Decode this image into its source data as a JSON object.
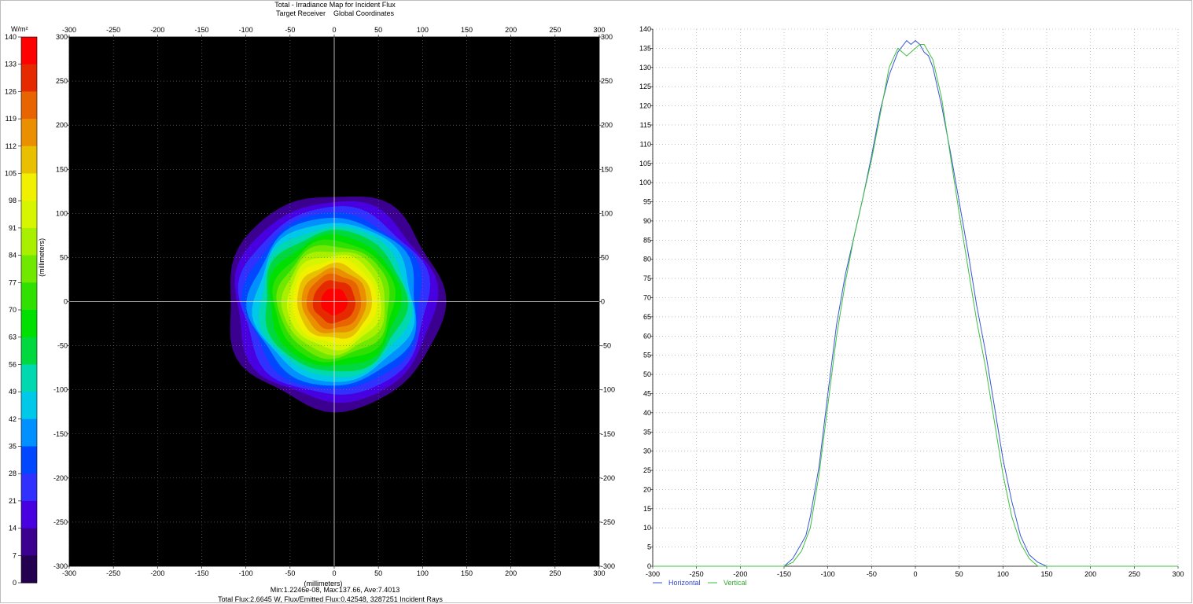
{
  "header": {
    "title": "Total - Irradiance Map for Incident Flux",
    "subtitle": "Target Receiver    Global Coordinates"
  },
  "footer": {
    "stats": "Min:1.2246e-08, Max:137.66, Ave:7.4013",
    "flux": "Total Flux:2.6645 W, Flux/Emitted Flux:0.42548, 3287251 Incident Rays"
  },
  "colors": {
    "background_map": "#000000",
    "horizontal": "#3a55d6",
    "vertical": "#3fbf3f",
    "legend_text_horizontal": "#2f46c8",
    "legend_text_vertical": "#2ea82e"
  },
  "chart_data": [
    {
      "type": "heatmap",
      "title": "Total - Irradiance Map for Incident Flux",
      "xlabel": "(millimeters)",
      "ylabel": "(millimeters)",
      "xlim": [
        -300,
        300
      ],
      "ylim": [
        -300,
        300
      ],
      "xticks": [
        "-300",
        "-250",
        "-200",
        "-150",
        "-100",
        "-50",
        "0",
        "50",
        "100",
        "150",
        "200",
        "250",
        "300"
      ],
      "yticks": [
        "300",
        "250",
        "200",
        "150",
        "100",
        "50",
        "0",
        "-50",
        "-100",
        "-150",
        "-200",
        "-250",
        "-300"
      ],
      "grid": true,
      "peak_center": [
        0,
        0
      ],
      "colorbar": {
        "unit": "W/m²",
        "ticks": [
          "140",
          "133",
          "126",
          "119",
          "112",
          "105",
          "98",
          "91",
          "84",
          "77",
          "70",
          "63",
          "56",
          "49",
          "42",
          "35",
          "28",
          "21",
          "14",
          "7",
          "0"
        ],
        "colors": [
          "#ff0000",
          "#e52a00",
          "#e86400",
          "#ea9000",
          "#e8c000",
          "#f0f000",
          "#d8f500",
          "#a8f000",
          "#70e800",
          "#30e000",
          "#00e000",
          "#00d840",
          "#00d8b0",
          "#00c8e8",
          "#0090ff",
          "#0048ff",
          "#3030ff",
          "#4800e0",
          "#3c0090",
          "#240050",
          "#000000"
        ]
      }
    },
    {
      "type": "line",
      "xlim": [
        -300,
        300
      ],
      "ylim": [
        0,
        140
      ],
      "xticks": [
        "-300",
        "-250",
        "-200",
        "-150",
        "-100",
        "-50",
        "0",
        "50",
        "100",
        "150",
        "200",
        "250",
        "300"
      ],
      "yticks": [
        "0",
        "5",
        "10",
        "15",
        "20",
        "25",
        "30",
        "35",
        "40",
        "45",
        "50",
        "55",
        "60",
        "65",
        "70",
        "75",
        "80",
        "85",
        "90",
        "95",
        "100",
        "105",
        "110",
        "115",
        "120",
        "125",
        "130",
        "135",
        "140"
      ],
      "grid": true,
      "legend_position": "bottom-left",
      "series": [
        {
          "name": "Horizontal",
          "x": [
            -300,
            -160,
            -150,
            -140,
            -130,
            -125,
            -120,
            -110,
            -100,
            -90,
            -80,
            -70,
            -60,
            -50,
            -40,
            -30,
            -20,
            -10,
            -5,
            0,
            5,
            10,
            15,
            20,
            30,
            40,
            50,
            60,
            70,
            80,
            90,
            100,
            110,
            120,
            130,
            140,
            150,
            160,
            300
          ],
          "y": [
            0,
            0,
            0,
            2,
            6,
            8,
            13,
            26,
            45,
            63,
            76,
            86,
            96,
            107,
            119,
            128,
            134,
            137,
            136,
            137,
            136,
            134,
            133,
            130,
            120,
            108,
            95,
            82,
            68,
            56,
            42,
            28,
            17,
            8,
            3,
            1,
            0,
            0,
            0
          ]
        },
        {
          "name": "Vertical",
          "x": [
            -300,
            -160,
            -150,
            -140,
            -130,
            -120,
            -110,
            -100,
            -90,
            -80,
            -70,
            -60,
            -50,
            -40,
            -30,
            -20,
            -15,
            -10,
            -5,
            0,
            5,
            10,
            20,
            30,
            40,
            50,
            60,
            70,
            80,
            90,
            100,
            110,
            120,
            130,
            140,
            150,
            300
          ],
          "y": [
            0,
            0,
            0,
            1,
            4,
            10,
            24,
            42,
            60,
            74,
            86,
            96,
            106,
            118,
            130,
            135,
            134,
            133,
            134,
            135,
            136,
            136,
            132,
            122,
            107,
            92,
            78,
            64,
            52,
            38,
            24,
            13,
            6,
            2,
            0,
            0,
            0
          ]
        }
      ]
    }
  ]
}
